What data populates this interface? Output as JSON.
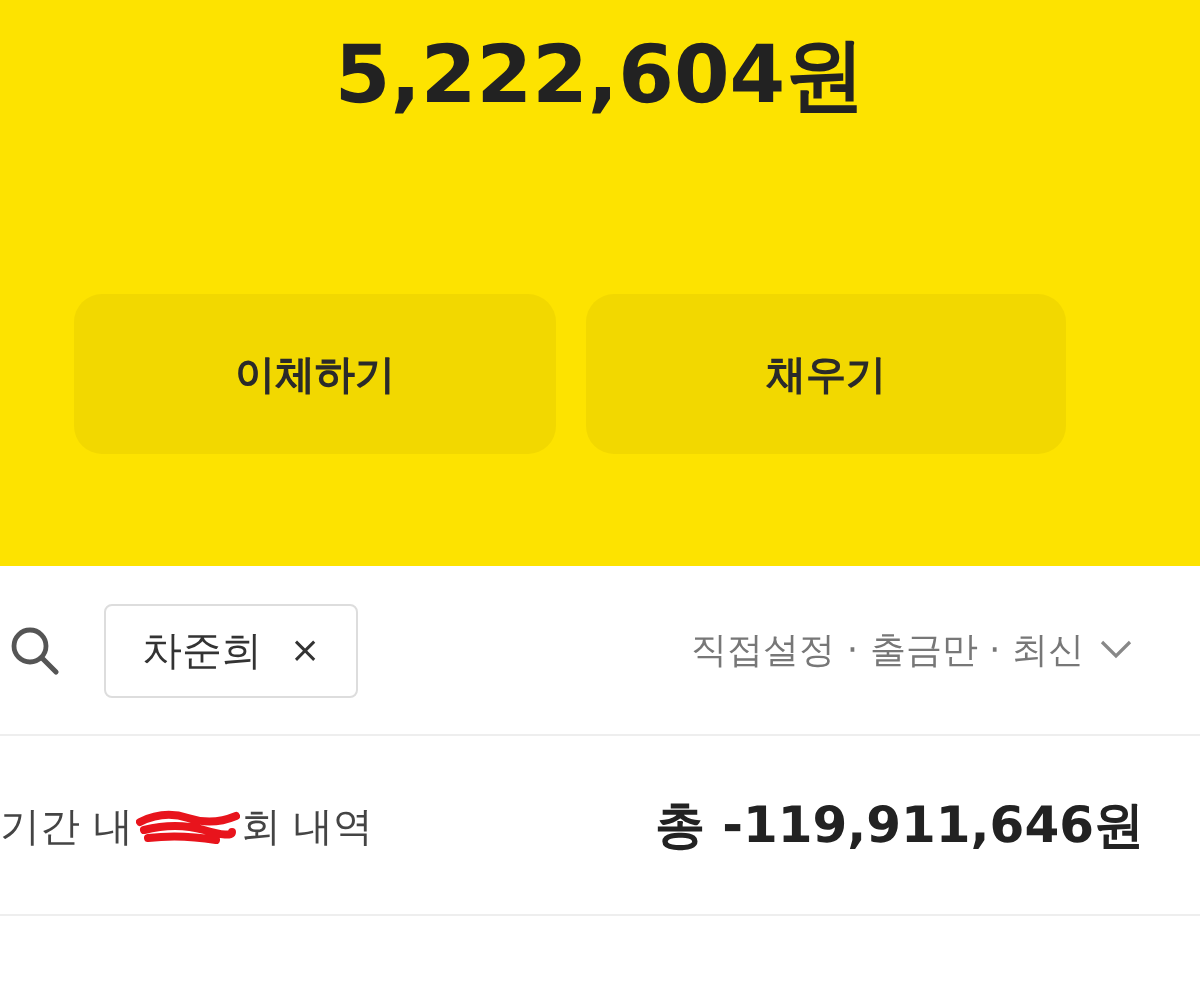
{
  "balance": "5,222,604원",
  "actions": [
    {
      "label": "이체하기"
    },
    {
      "label": "채우기"
    }
  ],
  "search_chip": {
    "label": "차준희",
    "remove": "×"
  },
  "filter": {
    "label": "직접설정 · 출금만 · 최신"
  },
  "summary": {
    "prefix": "기간 내",
    "suffix": "회 내역",
    "total": "총 -119,911,646원"
  }
}
